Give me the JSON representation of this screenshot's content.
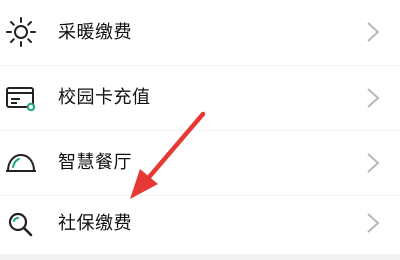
{
  "menu": {
    "items": [
      {
        "label": "采暖缴费",
        "icon": "sun-icon"
      },
      {
        "label": "校园卡充值",
        "icon": "card-icon"
      },
      {
        "label": "智慧餐厅",
        "icon": "dish-cover-icon"
      },
      {
        "label": "社保缴费",
        "icon": "search-icon"
      }
    ]
  },
  "colors": {
    "accent_green": "#19a974",
    "arrow_red": "#e53935",
    "text": "#111111",
    "chevron": "#b8b8b8"
  }
}
